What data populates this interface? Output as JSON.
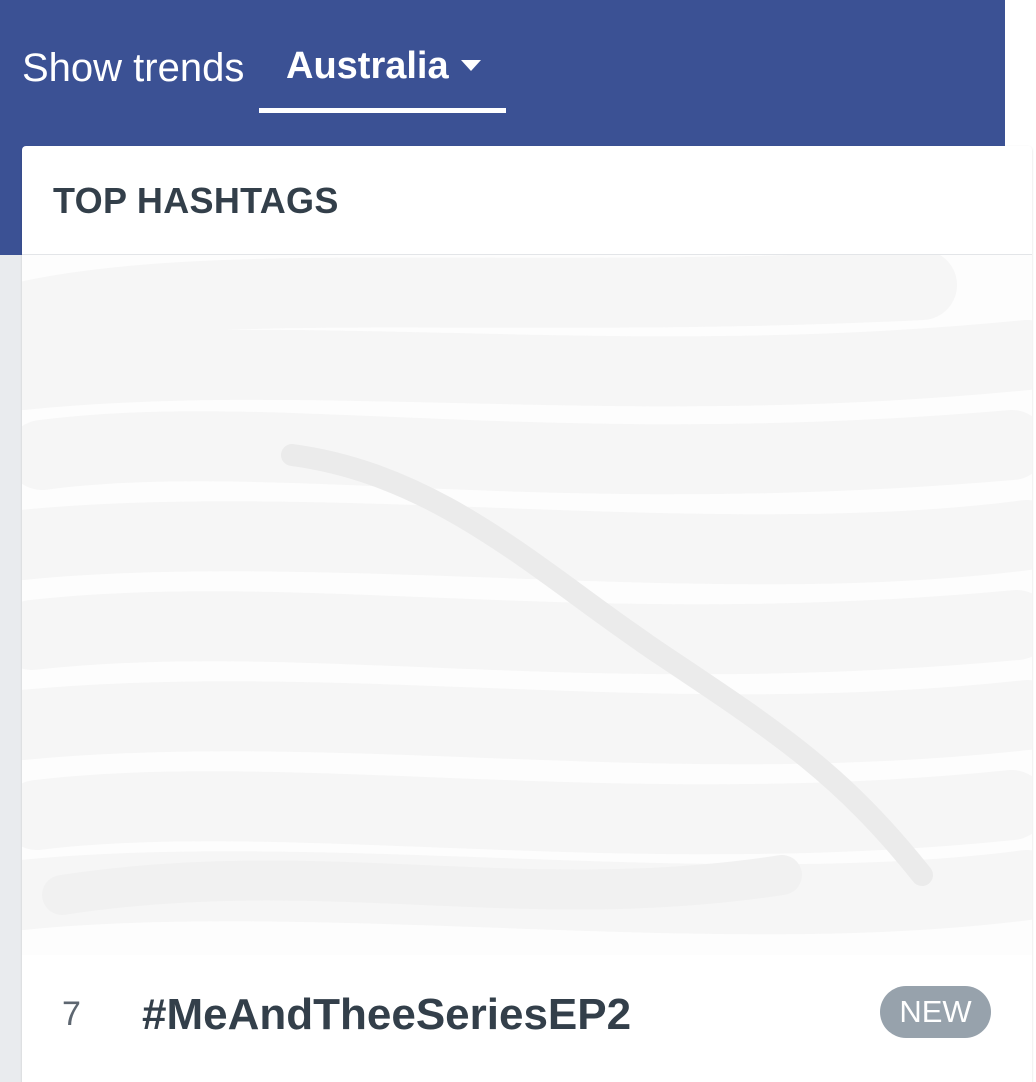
{
  "header": {
    "show_trends_label": "Show trends",
    "country": "Australia"
  },
  "card": {
    "title": "TOP HASHTAGS"
  },
  "hashtags": [
    {
      "rank": "7",
      "name": "#MeAndTheeSeriesEP2",
      "badge": "NEW"
    }
  ],
  "colors": {
    "header_background": "#3b5194",
    "title_text": "#333f4a",
    "badge_background": "#97a2ac"
  },
  "icons": {
    "dropdown": "chevron-down-icon"
  }
}
